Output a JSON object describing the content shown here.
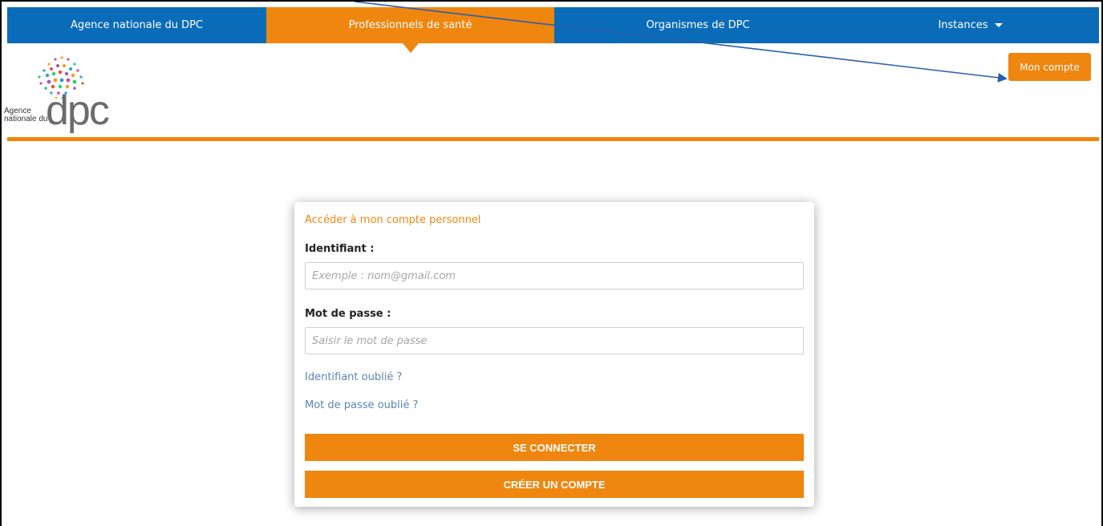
{
  "nav": {
    "items": [
      {
        "label": "Agence nationale du DPC"
      },
      {
        "label": "Professionnels de santé"
      },
      {
        "label": "Organismes de DPC"
      },
      {
        "label": "Instances"
      }
    ],
    "active_index": 1
  },
  "logo": {
    "line1": "Agence",
    "line2": "nationale du",
    "mark": "dpc"
  },
  "header": {
    "account_button": "Mon compte"
  },
  "login": {
    "title": "Accéder à mon compte personnel",
    "id_label": "Identifiant :",
    "id_placeholder": "Exemple : nom@gmail.com",
    "pwd_label": "Mot de passe :",
    "pwd_placeholder": "Saisir le mot de passe",
    "forgot_id": "Identifiant oublié ?",
    "forgot_pwd": "Mot de passe oublié ?",
    "login_button": "SE CONNECTER",
    "create_button": "CRÉER UN COMPTE"
  },
  "colors": {
    "brand_blue": "#0a6cb8",
    "brand_orange": "#ef860f",
    "link_blue": "#5b85b5",
    "annotation_arrow": "#2a5db0"
  },
  "icons": [
    "caret-down-icon",
    "dpc-logo"
  ]
}
